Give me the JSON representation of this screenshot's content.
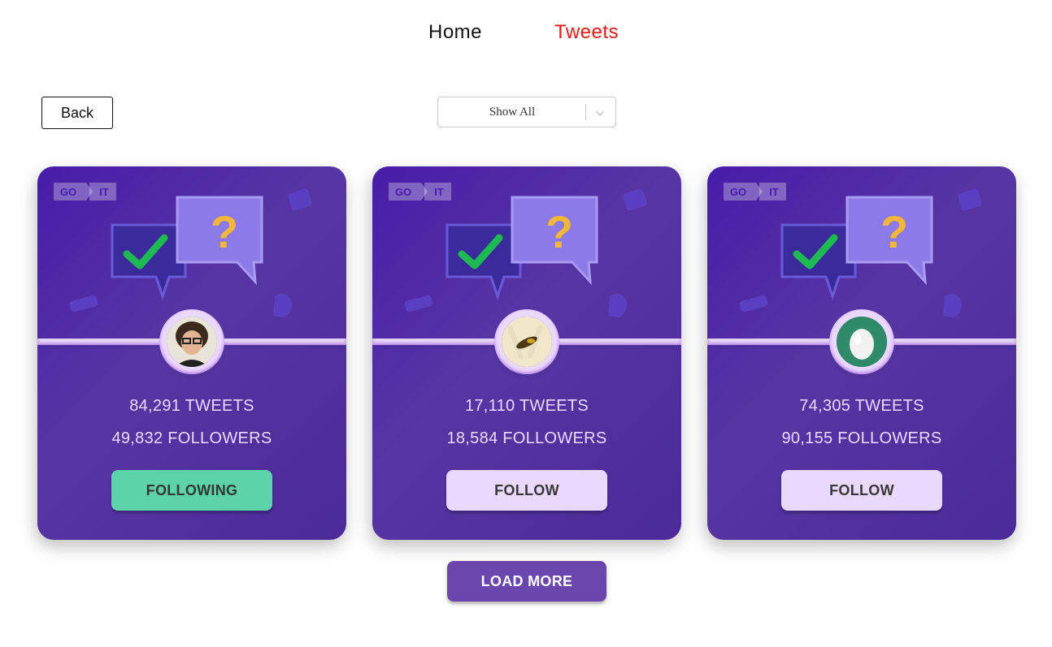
{
  "nav": {
    "home": "Home",
    "tweets": "Tweets"
  },
  "controls": {
    "back_label": "Back",
    "filter": {
      "selected": "Show All"
    }
  },
  "logo": {
    "left": "GO",
    "right": "IT"
  },
  "cards": [
    {
      "tweets": "84,291 TWEETS",
      "followers": "49,832 FOLLOWERS",
      "button": "FOLLOWING",
      "following": true,
      "avatar": "avatar-person"
    },
    {
      "tweets": "17,110 TWEETS",
      "followers": "18,584 FOLLOWERS",
      "button": "FOLLOW",
      "following": false,
      "avatar": "avatar-insect"
    },
    {
      "tweets": "74,305 TWEETS",
      "followers": "90,155 FOLLOWERS",
      "button": "FOLLOW",
      "following": false,
      "avatar": "avatar-egg"
    }
  ],
  "load_more": "LOAD MORE",
  "colors": {
    "accent": "#e31b1b",
    "card": "#5736a3",
    "button": "#ebd8ff",
    "following": "#5cd3a8",
    "load_more": "#6a47ae"
  }
}
